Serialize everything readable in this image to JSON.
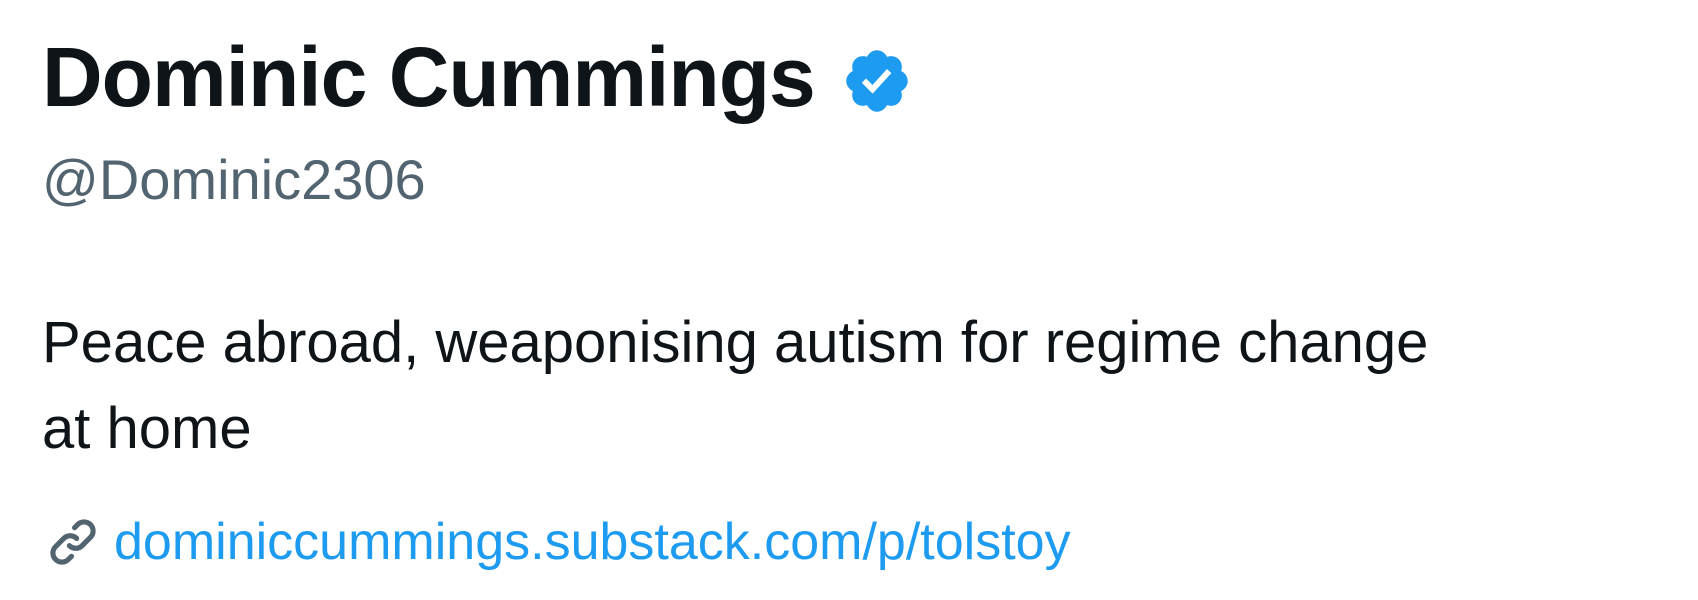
{
  "profile": {
    "display_name": "Dominic Cummings",
    "verified_badge_icon": "verified-badge-icon",
    "verified_color": "#1d9bf0",
    "handle": "@Dominic2306",
    "bio_line1": "Peace abroad, weaponising autism for regime change",
    "bio_line2": "at home",
    "link_icon": "link-icon",
    "website": "dominiccummings.substack.com/p/tolstoy"
  },
  "colors": {
    "name": "#0f1419",
    "handle": "#536471",
    "link": "#1d9bf0"
  }
}
